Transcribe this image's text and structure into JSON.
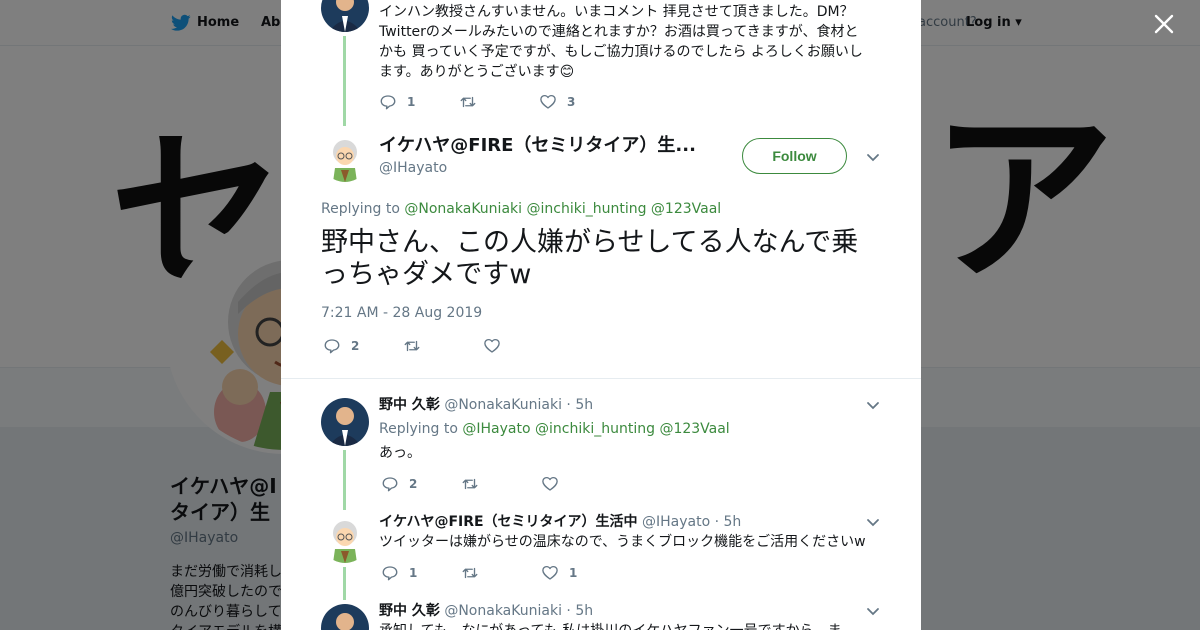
{
  "background": {
    "nav": {
      "home": "Home",
      "about": "Abo",
      "account": "account?",
      "login": "Log in"
    },
    "banner": {
      "char1": "セ",
      "char2": "ア"
    },
    "profile": {
      "name_line1": "イケハヤ@I",
      "name_line2": "タイア）生",
      "handle": "@IHayato",
      "bio_lines": [
        "まだ労働で消耗し",
        "億円突破したので",
        "のんびり暮らして",
        "タイアモデルを構"
      ]
    }
  },
  "thread": {
    "prev_tweet": {
      "text": "インハン教授さんすいません。いまコメント 拝見させて頂きました。DM？Twitterのメールみたいので連絡とれますか？お酒は買ってきますが、食材とかも 買っていく予定ですが、もしご協力頂けるのでしたら よろしくお願いします。ありがとうございます",
      "emoji": "😊",
      "replies": "1",
      "likes": "3"
    },
    "main_tweet": {
      "name": "イケハヤ@FIRE（セミリタイア）生...",
      "handle": "@IHayato",
      "follow_label": "Follow",
      "replying_to_label": "Replying to",
      "mentions": [
        "@NonakaKuniaki",
        "@inchiki_hunting",
        "@123Vaal"
      ],
      "text": "野中さん、この人嫌がらせしてる人なんで乗っちゃダメですw",
      "timestamp": "7:21 AM - 28 Aug 2019",
      "replies": "2"
    },
    "replies": [
      {
        "name": "野中 久彰",
        "handle": "@NonakaKuniaki",
        "time": "· 5h",
        "replying_to_label": "Replying to",
        "mentions": [
          "@IHayato",
          "@inchiki_hunting",
          "@123Vaal"
        ],
        "text": "あっ。",
        "replies": "2",
        "likes": ""
      },
      {
        "name": "イケハヤ@FIRE（セミリタイア）生活中",
        "handle": "@IHayato",
        "time": "· 5h",
        "text": "ツイッターは嫌がらせの温床なので、うまくブロック機能をご活用くださいw",
        "replies": "1",
        "likes": "1"
      },
      {
        "name": "野中 久彰",
        "handle": "@NonakaKuniaki",
        "time": "· 5h",
        "text": "承知しても、なにがあっても 私は掛川のイケハヤファン一号ですから、ま"
      }
    ]
  },
  "colors": {
    "accent": "#3c8a3e",
    "muted": "#657786",
    "text": "#14171a",
    "thread_line": "#a0d8a6"
  },
  "icons": {
    "close": "close-icon",
    "twitter": "twitter-bird-icon",
    "reply": "reply-icon",
    "retweet": "retweet-icon",
    "like": "heart-icon",
    "caret": "chevron-down-icon"
  }
}
